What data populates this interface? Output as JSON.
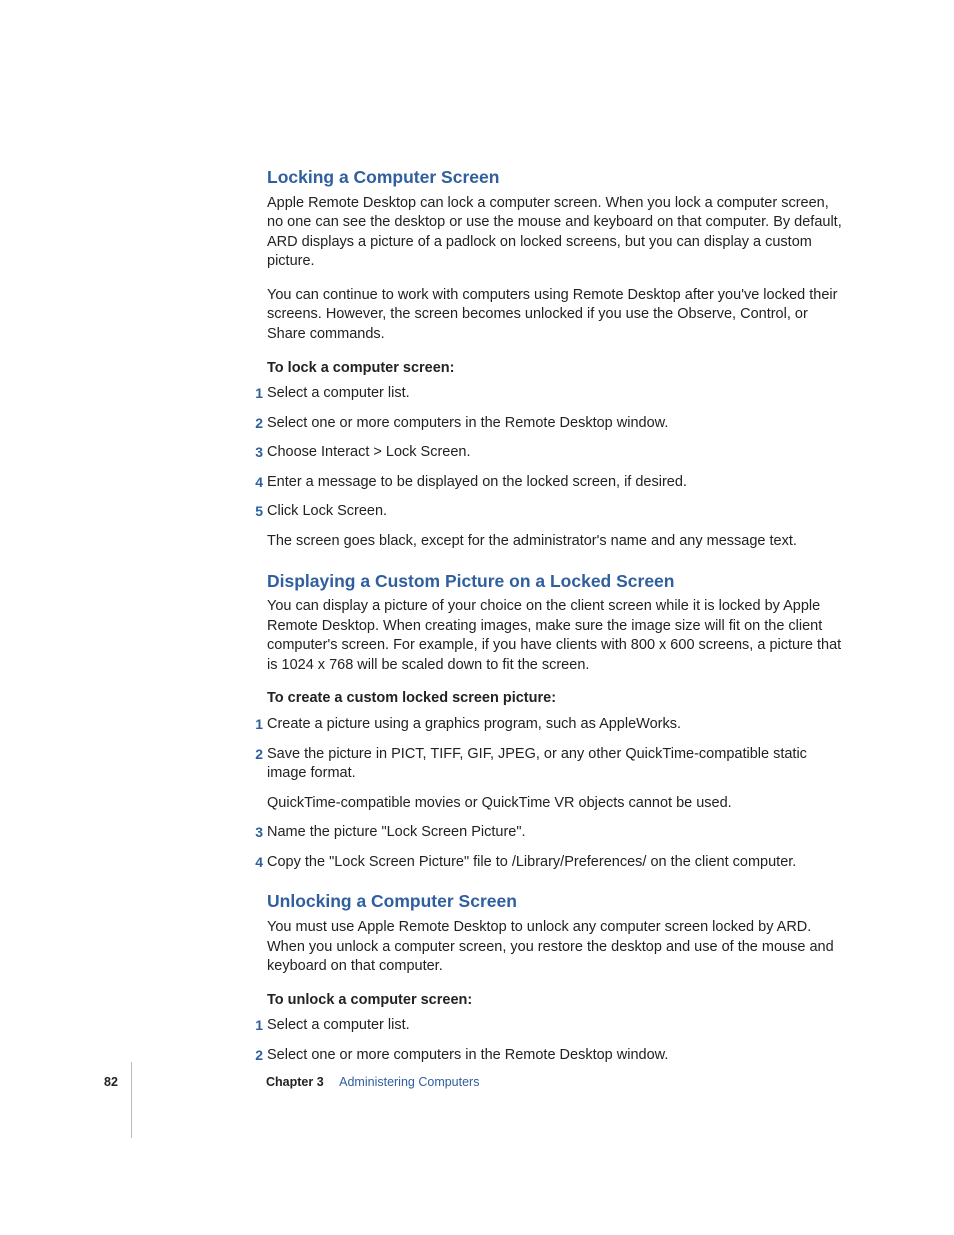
{
  "sections": [
    {
      "heading": "Locking a Computer Screen",
      "paras": [
        "Apple Remote Desktop can lock a computer screen. When you lock a computer screen, no one can see the desktop or use the mouse and keyboard on that computer. By default, ARD displays a picture of a padlock on locked screens, but you can display a custom picture.",
        "You can continue to work with computers using Remote Desktop after you've locked their screens. However, the screen becomes unlocked if you use the Observe, Control, or Share commands."
      ],
      "lead": "To lock a computer screen:",
      "steps": [
        {
          "text": "Select a computer list."
        },
        {
          "text": "Select one or more computers in the Remote Desktop window."
        },
        {
          "text": "Choose Interact > Lock Screen."
        },
        {
          "text": "Enter a message to be displayed on the locked screen, if desired."
        },
        {
          "text": "Click Lock Screen.",
          "after": "The screen goes black, except for the administrator's name and any message text."
        }
      ]
    },
    {
      "heading": "Displaying a Custom Picture on a Locked Screen",
      "paras": [
        "You can display a picture of your choice on the client screen while it is locked by Apple Remote Desktop. When creating images, make sure the image size will fit on the client computer's screen. For example, if you have clients with 800 x 600 screens, a picture that is 1024 x 768 will be scaled down to fit the screen."
      ],
      "lead": "To create a custom locked screen picture:",
      "steps": [
        {
          "text": "Create a picture using a graphics program, such as AppleWorks."
        },
        {
          "text": "Save the picture in PICT, TIFF, GIF, JPEG, or any other QuickTime-compatible static image format.",
          "after": "QuickTime-compatible movies or QuickTime VR objects cannot be used."
        },
        {
          "text": "Name the picture \"Lock Screen Picture\"."
        },
        {
          "text": "Copy the \"Lock Screen Picture\" file to /Library/Preferences/ on the client computer."
        }
      ]
    },
    {
      "heading": "Unlocking a Computer Screen",
      "paras": [
        "You must use Apple Remote Desktop to unlock any computer screen locked by ARD. When you unlock a computer screen, you restore the desktop and use of the mouse and keyboard on that computer."
      ],
      "lead": "To unlock a computer screen:",
      "steps": [
        {
          "text": "Select a computer list."
        },
        {
          "text": "Select one or more computers in the Remote Desktop window."
        }
      ]
    }
  ],
  "footer": {
    "page": "82",
    "chapter_label": "Chapter 3",
    "chapter_title": "Administering Computers"
  }
}
